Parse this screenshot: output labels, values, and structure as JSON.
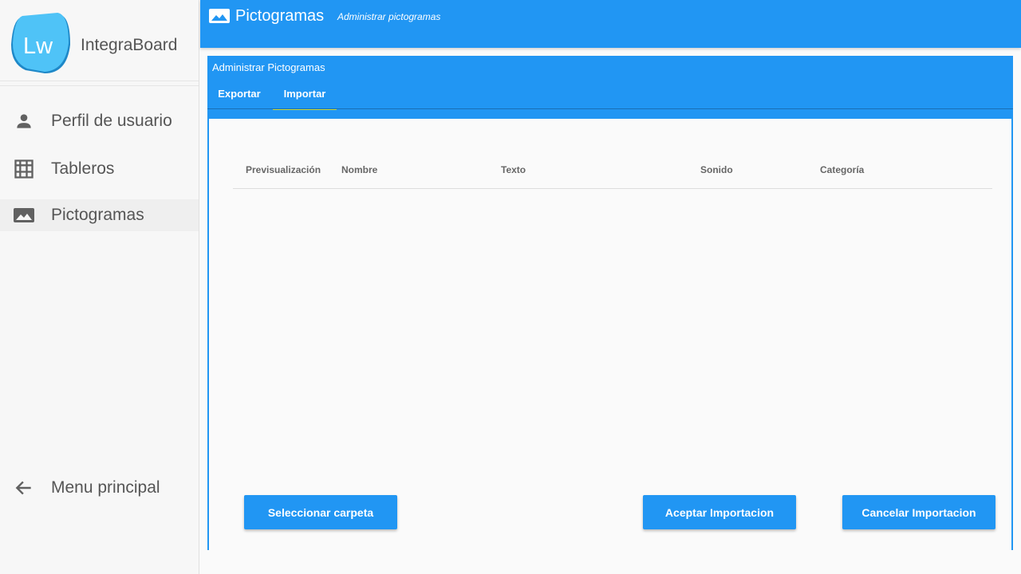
{
  "app": {
    "name": "IntegraBoard",
    "logo_text": "Lw"
  },
  "sidebar": {
    "items": [
      {
        "label": "Perfil de usuario",
        "icon": "person-icon"
      },
      {
        "label": "Tableros",
        "icon": "grid-icon"
      },
      {
        "label": "Pictogramas",
        "icon": "image-icon"
      }
    ],
    "back": {
      "label": "Menu principal",
      "icon": "arrow-left-icon"
    }
  },
  "topbar": {
    "title": "Pictogramas",
    "subtitle": "Administrar pictogramas"
  },
  "panel": {
    "title": "Administrar Pictogramas",
    "tabs": [
      {
        "label": "Exportar"
      },
      {
        "label": "Importar",
        "active": true
      }
    ],
    "columns": [
      "Previsualización",
      "Nombre",
      "Texto",
      "Sonido",
      "Categoría"
    ],
    "rows": [],
    "buttons": {
      "select": "Seleccionar carpeta",
      "accept": "Aceptar Importacion",
      "cancel": "Cancelar Importacion"
    }
  },
  "colors": {
    "primary": "#2196f3",
    "tab_indicator": "#cddc39",
    "logo": "#4fc3f7"
  }
}
